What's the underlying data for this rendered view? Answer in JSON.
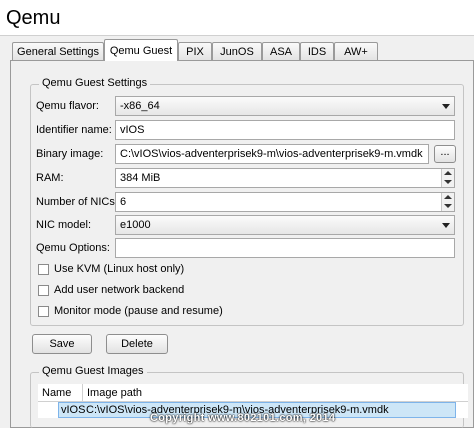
{
  "window": {
    "title": "Qemu"
  },
  "tabs": [
    {
      "label": "General Settings"
    },
    {
      "label": "Qemu Guest"
    },
    {
      "label": "PIX"
    },
    {
      "label": "JunOS"
    },
    {
      "label": "ASA"
    },
    {
      "label": "IDS"
    },
    {
      "label": "AW+"
    }
  ],
  "settings": {
    "title": "Qemu Guest Settings",
    "flavor": {
      "label": "Qemu flavor:",
      "value": "-x86_64"
    },
    "identifier": {
      "label": "Identifier name:",
      "value": "vIOS"
    },
    "binary": {
      "label": "Binary image:",
      "value": "C:\\vIOS\\vios-adventerprisek9-m\\vios-adventerprisek9-m.vmdk",
      "browse_label": "..."
    },
    "ram": {
      "label": "RAM:",
      "value": "384 MiB"
    },
    "nics": {
      "label": "Number of NICs:",
      "value": "6"
    },
    "nic_model": {
      "label": "NIC model:",
      "value": "e1000"
    },
    "options": {
      "label": "Qemu Options:",
      "value": ""
    },
    "kvm": {
      "label": "Use KVM (Linux host only)"
    },
    "user_net": {
      "label": "Add user network backend"
    },
    "monitor": {
      "label": "Monitor mode (pause and resume)"
    }
  },
  "buttons": {
    "save": "Save",
    "delete": "Delete"
  },
  "images": {
    "title": "Qemu Guest Images",
    "columns": [
      "Name",
      "Image path"
    ],
    "rows": [
      {
        "name": "vIOS",
        "path": "C:\\vIOS\\vios-adventerprisek9-m\\vios-adventerprisek9-m.vmdk"
      }
    ]
  },
  "watermark": "Copyright www.802101.com, 2014"
}
